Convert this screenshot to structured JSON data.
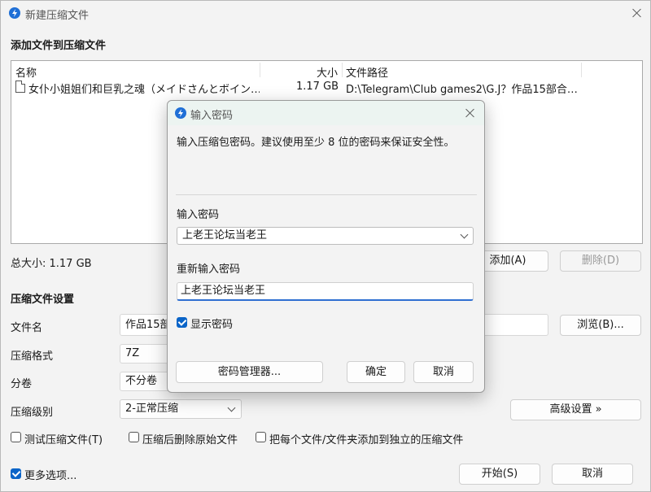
{
  "main_window": {
    "title": "新建压缩文件",
    "section_add": "添加文件到压缩文件",
    "columns": {
      "name": "名称",
      "size": "大小",
      "path": "文件路径"
    },
    "files": [
      {
        "name": "女仆小姐姐们和巨乳之魂（メイドさんとボイン…",
        "size": "1.17 GB",
        "path": "D:\\Telegram\\Club games2\\G.J？作品15部合…"
      }
    ],
    "total_size": "总大小: 1.17 GB",
    "add_button": "添加(A)",
    "delete_button": "删除(D)",
    "section_settings": "压缩文件设置",
    "filename_label": "文件名",
    "filename_value": "作品15部",
    "browse_button": "浏览(B)...",
    "format_label": "压缩格式",
    "format_value": "7Z",
    "split_label": "分卷",
    "split_value": "不分卷",
    "level_label": "压缩级别",
    "level_value": "2-正常压缩",
    "advanced_button": "高级设置 »",
    "check_test": "测试压缩文件(T)",
    "check_delete": "压缩后删除原始文件",
    "check_separate": "把每个文件/文件夹添加到独立的压缩文件",
    "more_options": "更多选项...",
    "start_button": "开始(S)",
    "cancel_button": "取消"
  },
  "dialog": {
    "title": "输入密码",
    "description": "输入压缩包密码。建议使用至少 8 位的密码来保证安全性。",
    "password_label": "输入密码",
    "password_value": "上老王论坛当老王",
    "confirm_label": "重新输入密码",
    "confirm_value": "上老王论坛当老王",
    "show_password": "显示密码",
    "manager_button": "密码管理器...",
    "ok_button": "确定",
    "cancel_button": "取消"
  },
  "colors": {
    "accent": "#0a64c8",
    "app_icon": "#1f6fd6",
    "dialog_title_bg": "#ecf4f1"
  }
}
